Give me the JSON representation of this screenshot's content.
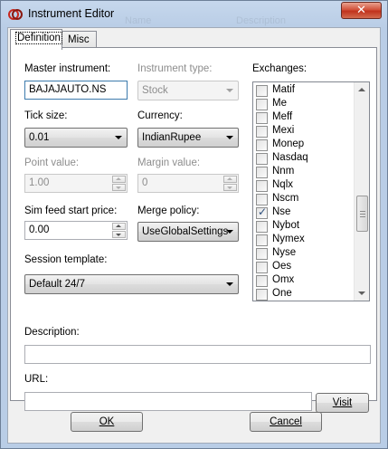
{
  "window": {
    "title": "Instrument Editor",
    "close_glyph": "✕",
    "ghost_headers": [
      "Name",
      "Description"
    ]
  },
  "tabs": [
    {
      "label": "Definition",
      "active": true
    },
    {
      "label": "Misc",
      "active": false
    }
  ],
  "form": {
    "master_instrument": {
      "label": "Master instrument:",
      "value": "BAJAJAUTO.NS"
    },
    "instrument_type": {
      "label": "Instrument type:",
      "value": "Stock",
      "disabled": true
    },
    "tick_size": {
      "label": "Tick size:",
      "value": "0.01"
    },
    "currency": {
      "label": "Currency:",
      "value": "IndianRupee"
    },
    "point_value": {
      "label": "Point value:",
      "value": "1.00",
      "disabled": true
    },
    "margin_value": {
      "label": "Margin value:",
      "value": "0",
      "disabled": true
    },
    "sim_feed_start_price": {
      "label": "Sim feed start price:",
      "value": "0.00"
    },
    "merge_policy": {
      "label": "Merge policy:",
      "value": "UseGlobalSettings"
    },
    "session_template": {
      "label": "Session template:",
      "value": "Default 24/7"
    },
    "description": {
      "label": "Description:",
      "value": ""
    },
    "url": {
      "label": "URL:",
      "value": ""
    },
    "visit_button": "Visit"
  },
  "exchanges": {
    "label": "Exchanges:",
    "items": [
      {
        "name": "Matif",
        "checked": false
      },
      {
        "name": "Me",
        "checked": false
      },
      {
        "name": "Meff",
        "checked": false
      },
      {
        "name": "Mexi",
        "checked": false
      },
      {
        "name": "Monep",
        "checked": false
      },
      {
        "name": "Nasdaq",
        "checked": false
      },
      {
        "name": "Nnm",
        "checked": false
      },
      {
        "name": "Nqlx",
        "checked": false
      },
      {
        "name": "Nscm",
        "checked": false
      },
      {
        "name": "Nse",
        "checked": true
      },
      {
        "name": "Nybot",
        "checked": false
      },
      {
        "name": "Nymex",
        "checked": false
      },
      {
        "name": "Nyse",
        "checked": false
      },
      {
        "name": "Oes",
        "checked": false
      },
      {
        "name": "Omx",
        "checked": false
      },
      {
        "name": "One",
        "checked": false
      }
    ]
  },
  "footer": {
    "ok": "OK",
    "cancel": "Cancel"
  },
  "colors": {
    "titlebar": "#b9cde6",
    "close_button": "#c0331d",
    "panel_bg": "#ffffff",
    "dialog_bg": "#f0f0f0"
  },
  "icons": {
    "app": "ninjatrader-logo-icon",
    "close": "close-icon",
    "dropdown": "chevron-down-icon",
    "spinner": "spinner-arrows-icon",
    "checkbox": "checkbox-icon"
  }
}
